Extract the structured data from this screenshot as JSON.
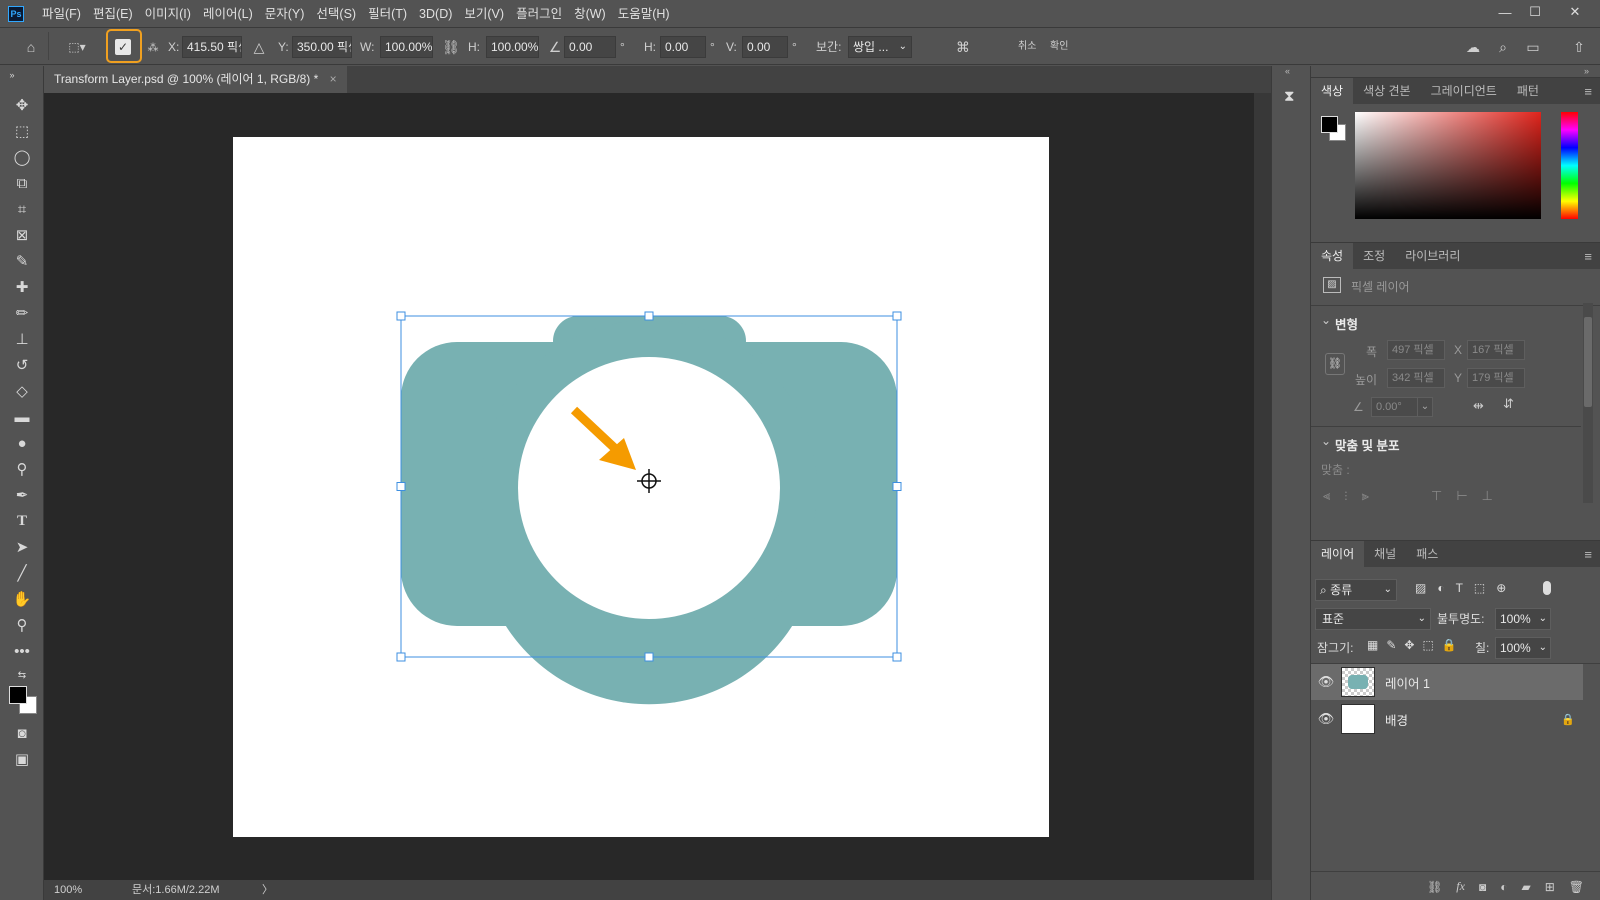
{
  "app": {
    "logo": "Ps"
  },
  "menu": [
    "파일(F)",
    "편집(E)",
    "이미지(I)",
    "레이어(L)",
    "문자(Y)",
    "선택(S)",
    "필터(T)",
    "3D(D)",
    "보기(V)",
    "플러그인",
    "창(W)",
    "도움말(H)"
  ],
  "window_controls": {
    "minimize": "—",
    "maximize": "☐",
    "close": "✕"
  },
  "options": {
    "x_label": "X:",
    "x_value": "415.50 픽셀",
    "y_label": "Y:",
    "y_value": "350.00 픽셀",
    "w_label": "W:",
    "w_value": "100.00%",
    "h_label": "H:",
    "h_value": "100.00%",
    "angle_value": "0.00",
    "degree_symbol": "°",
    "hskew_label": "H:",
    "hskew_value": "0.00",
    "vskew_label": "V:",
    "vskew_value": "0.00",
    "interp_label": "보간:",
    "interp_value": "쌍입 ...",
    "cancel_label": "취소",
    "commit_label": "확인"
  },
  "document": {
    "tab_title": "Transform Layer.psd @ 100% (레이어 1, RGB/8) *",
    "zoom": "100%",
    "doc_size": "문서:1.66M/2.22M"
  },
  "color_panel": {
    "tabs": [
      "색상",
      "색상 견본",
      "그레이디언트",
      "패턴"
    ]
  },
  "properties_panel": {
    "tabs": [
      "속성",
      "조정",
      "라이브러리"
    ],
    "kind": "픽셀 레이어",
    "transform_title": "변형",
    "width_label": "폭",
    "width_value": "497 픽셀",
    "height_label": "높이",
    "height_value": "342 픽셀",
    "x_label": "X",
    "x_value": "167 픽셀",
    "y_label": "Y",
    "y_value": "179 픽셀",
    "angle_value": "0.00°",
    "align_title": "맞춤 및 분포",
    "align_label": "맞춤 :"
  },
  "layers_panel": {
    "tabs": [
      "레이어",
      "채널",
      "패스"
    ],
    "filter_value": "종류",
    "blend_mode": "표준",
    "opacity_label": "불투명도:",
    "opacity_value": "100%",
    "lock_label": "잠그기:",
    "fill_label": "칠:",
    "fill_value": "100%",
    "layers": [
      {
        "name": "레이어 1",
        "selected": true
      },
      {
        "name": "배경",
        "locked": true
      }
    ]
  },
  "colors": {
    "camera": "#78b1b2",
    "arrow": "#f59b00",
    "highlight": "#f0a020",
    "selection": "#3d8fe0"
  }
}
